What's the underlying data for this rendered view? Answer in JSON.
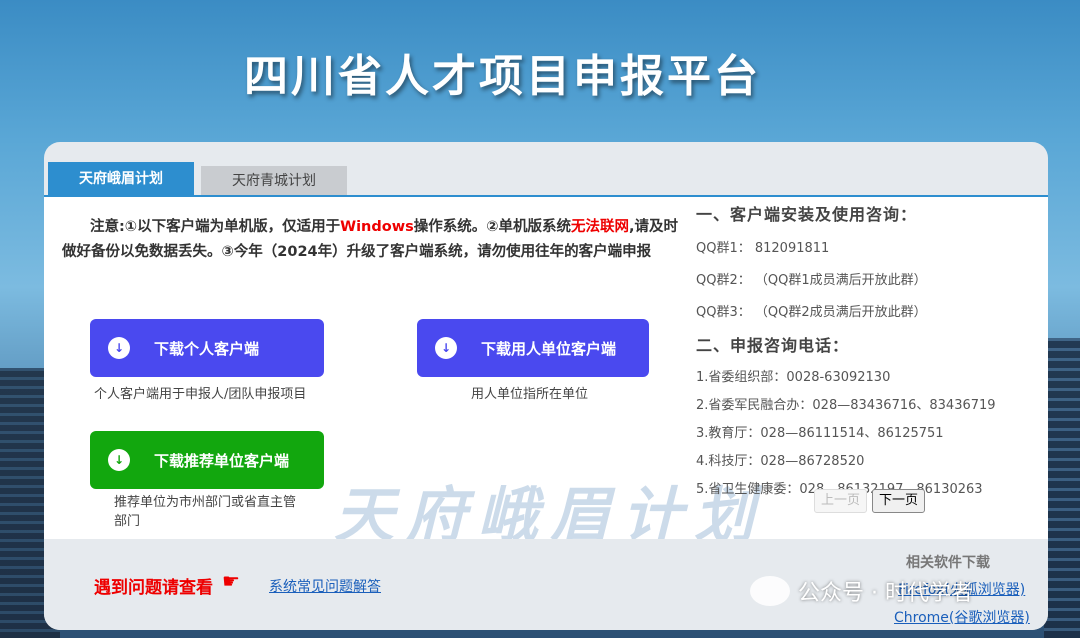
{
  "site_title": "四川省人才项目申报平台",
  "tabs": [
    {
      "label": "天府峨眉计划"
    },
    {
      "label": "天府青城计划"
    }
  ],
  "notice": {
    "part1": "注意:①以下客户端为单机版，仅适用于",
    "windows": "Windows",
    "part2": "操作系统。②单机版系统",
    "no_network": "无法联网",
    "part3": ",请及时做好备份以免数据丢失。③今年（2024年）升级了客户端系统，请勿使用往年的客户端申报"
  },
  "downloads": {
    "personal": {
      "label": "下载个人客户端",
      "caption": "个人客户端用于申报人/团队申报项目",
      "icon": "download-arrow-icon"
    },
    "employer": {
      "label": "下载用人单位客户端",
      "caption": "用人单位指所在单位",
      "icon": "download-arrow-icon"
    },
    "recommender": {
      "label": "下载推荐单位客户端",
      "caption": "推荐单位为市州部门或省直主管部门",
      "icon": "download-arrow-icon"
    }
  },
  "consult": {
    "section1_title": "一、客户端安装及使用咨询：",
    "qq": [
      "QQ群1：  812091811",
      "QQ群2：  （QQ群1成员满后开放此群）",
      "QQ群3：  （QQ群2成员满后开放此群）"
    ],
    "section2_title": "二、申报咨询电话：",
    "phones": [
      "1.省委组织部：0028-63092130",
      "2.省委军民融合办：028—83436716、83436719",
      "3.教育厅：028—86111514、86125751",
      "4.科技厅：028—86728520",
      "5.省卫生健康委：028—86132197、86130263"
    ]
  },
  "pager": {
    "prev": "上一页",
    "next": "下一页"
  },
  "watermark": "天府峨眉计划",
  "footer": {
    "help_label": "遇到问题请查看",
    "faq_link": "系统常见问题解答",
    "related_title": "相关软件下载",
    "firefox": "Firefox(火狐浏览器)",
    "chrome": "Chrome(谷歌浏览器)"
  },
  "wechat_badge": "公众号 · 时代学者",
  "colors": {
    "tab_active": "#2d8ecf",
    "btn_blue": "#4a49ef",
    "btn_green": "#12a70e",
    "alert_red": "#ee0000",
    "link": "#1a5fbb"
  }
}
